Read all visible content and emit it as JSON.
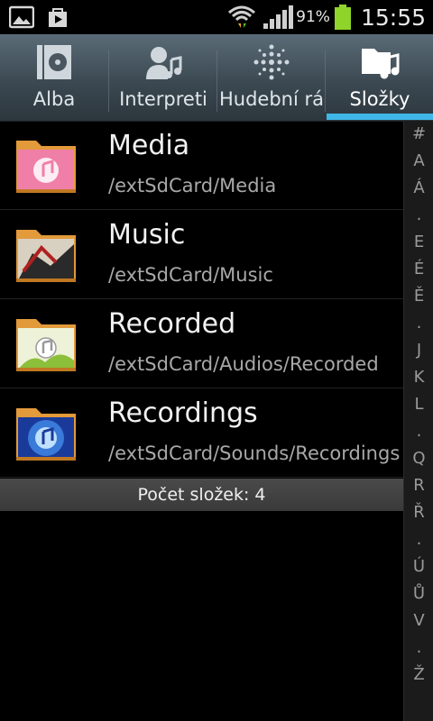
{
  "status_bar": {
    "battery_percent": "91%",
    "time": "15:55"
  },
  "tabs": [
    {
      "label": "Alba",
      "icon": "album-icon",
      "active": false
    },
    {
      "label": "Interpreti",
      "icon": "artist-icon",
      "active": false
    },
    {
      "label": "Hudební rá",
      "icon": "music-square-icon",
      "active": false
    },
    {
      "label": "Složky",
      "icon": "folder-music-icon",
      "active": true
    }
  ],
  "folders": [
    {
      "name": "Media",
      "path": "/extSdCard/Media"
    },
    {
      "name": "Music",
      "path": "/extSdCard/Music"
    },
    {
      "name": "Recorded",
      "path": "/extSdCard/Audios/Recorded"
    },
    {
      "name": "Recordings",
      "path": "/extSdCard/Sounds/Recordings"
    }
  ],
  "folder_count_label": "Počet složek: 4",
  "index_letters": [
    "#",
    "A",
    "Á",
    ".",
    "E",
    "É",
    "Ě",
    ".",
    "J",
    "K",
    "L",
    ".",
    "Q",
    "R",
    "Ř",
    ".",
    "Ú",
    "Ů",
    "V",
    ".",
    "Ž"
  ],
  "colors": {
    "accent": "#3fb7e8",
    "tab_bg": "#3c4952",
    "folder": "#e29a3a"
  }
}
